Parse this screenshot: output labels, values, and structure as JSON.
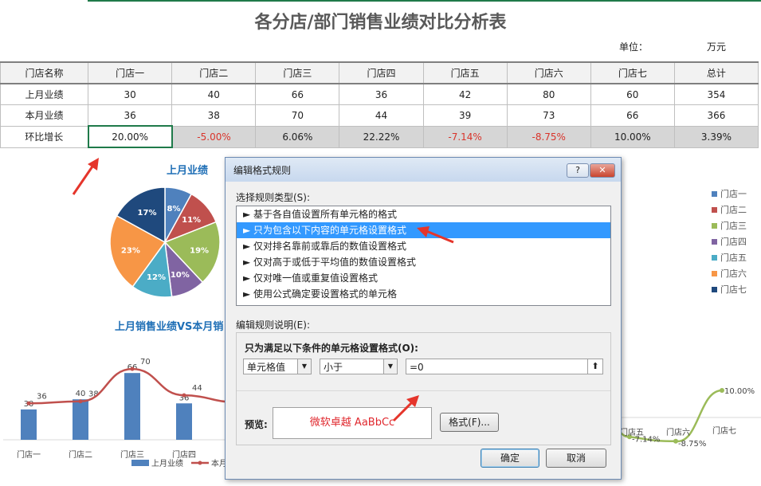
{
  "title": "各分店/部门销售业绩对比分析表",
  "unit_label": "单位：",
  "unit_value": "万元",
  "table": {
    "headers": [
      "门店名称",
      "门店一",
      "门店二",
      "门店三",
      "门店四",
      "门店五",
      "门店六",
      "门店七",
      "总计"
    ],
    "rows": [
      {
        "label": "上月业绩",
        "cells": [
          "30",
          "40",
          "66",
          "36",
          "42",
          "80",
          "60",
          "354"
        ]
      },
      {
        "label": "本月业绩",
        "cells": [
          "36",
          "38",
          "70",
          "44",
          "39",
          "73",
          "66",
          "366"
        ]
      },
      {
        "label": "环比增长",
        "cells": [
          "20.00%",
          "-5.00%",
          "6.06%",
          "22.22%",
          "-7.14%",
          "-8.75%",
          "10.00%",
          "3.39%"
        ]
      }
    ]
  },
  "pie_title": "上月业绩",
  "combo_title": "上月销售业绩VS本月销",
  "colors": {
    "blue": "#4f81bd",
    "red": "#c0504d",
    "green": "#9bbb59",
    "purple": "#8064a2",
    "teal": "#4bacc6",
    "orange": "#f79646",
    "navy": "#1f497d",
    "accent": "#1f7a4a"
  },
  "chart_data": [
    {
      "type": "pie",
      "title": "上月业绩",
      "labels": [
        "8%",
        "11%",
        "19%",
        "10%",
        "12%",
        "23%",
        "17%"
      ],
      "values": [
        8,
        11,
        19,
        10,
        12,
        23,
        17
      ],
      "legend": [
        "门店一",
        "门店二",
        "门店三",
        "门店四",
        "门店五",
        "门店六",
        "门店七"
      ],
      "legend_placement": "right"
    },
    {
      "type": "bar",
      "title": "上月销售业绩VS本月销",
      "categories": [
        "门店一",
        "门店二",
        "门店三",
        "门店四"
      ],
      "series": [
        {
          "name": "上月业绩",
          "type": "bar",
          "values": [
            30,
            40,
            66,
            36
          ]
        },
        {
          "name": "本月",
          "type": "line",
          "values": [
            36,
            38,
            70,
            44
          ]
        }
      ],
      "bar_labels": [
        "30",
        "40",
        "66",
        "36"
      ],
      "line_labels": [
        "36",
        "38",
        "70",
        "44"
      ]
    },
    {
      "type": "line",
      "categories": [
        "门店五",
        "门店六",
        "门店七"
      ],
      "values": [
        -7.14,
        -8.75,
        10.0
      ],
      "labels": [
        "-7.14%",
        "-8.75%",
        "10.00%"
      ]
    }
  ],
  "dialog": {
    "title": "编辑格式规则",
    "help": "?",
    "close": "✕",
    "select_rule_label": "选择规则类型(S):",
    "rules": [
      "► 基于各自值设置所有单元格的格式",
      "► 只为包含以下内容的单元格设置格式",
      "► 仅对排名靠前或靠后的数值设置格式",
      "► 仅对高于或低于平均值的数值设置格式",
      "► 仅对唯一值或重复值设置格式",
      "► 使用公式确定要设置格式的单元格"
    ],
    "edit_desc_label": "编辑规则说明(E):",
    "condition_label": "只为满足以下条件的单元格设置格式(O):",
    "combo1": "单元格值",
    "combo2": "小于",
    "value_field": "=0",
    "preview_label": "预览:",
    "preview_text": "微软卓越 AaBbCc",
    "format_button": "格式(F)...",
    "ok": "确定",
    "cancel": "取消"
  }
}
